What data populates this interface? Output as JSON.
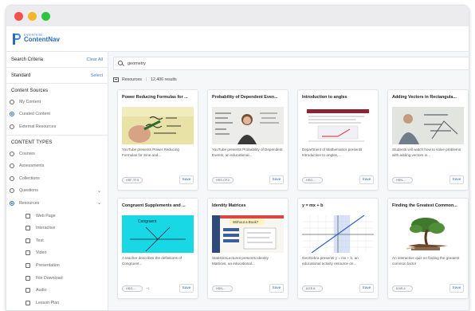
{
  "app": {
    "logo_small": "ENTERPRISE",
    "logo_big": "ContentNav"
  },
  "sidebar": {
    "search_criteria": "Search Criteria",
    "clear_all": "Clear All",
    "standard": "Standard",
    "select": "Select",
    "content_sources_heading": "Content Sources",
    "content_sources": [
      {
        "label": "My Content",
        "selected": false
      },
      {
        "label": "Curated Content",
        "selected": true
      },
      {
        "label": "External Resources",
        "selected": false
      }
    ],
    "content_types_heading": "CONTENT TYPES",
    "content_types": [
      {
        "label": "Courses",
        "selected": false,
        "expandable": false
      },
      {
        "label": "Assessments",
        "selected": false,
        "expandable": false
      },
      {
        "label": "Collections",
        "selected": false,
        "expandable": false
      },
      {
        "label": "Questions",
        "selected": false,
        "expandable": true
      },
      {
        "label": "Resources",
        "selected": true,
        "expandable": true
      }
    ],
    "resource_types": [
      "Web Page",
      "Interactive",
      "Text",
      "Video",
      "Presentation",
      "File Download",
      "Audio",
      "Lesson Plan"
    ]
  },
  "main": {
    "search_value": "geometry",
    "resources_label": "Resources",
    "results_count": "12,406 results",
    "save_label": "Save",
    "cards": [
      {
        "title": "Power Reducing Formulas for ...",
        "desc": "YouTube presents Power Reducing Formulas for Sine and...",
        "pill": "HSF-TF.5",
        "extra": ""
      },
      {
        "title": "Probability of Dependent Even...",
        "desc": "YouTube presents Probability of Dependent Events, an educational...",
        "pill": "HSS-CP.2",
        "extra": ""
      },
      {
        "title": "Introduction to angles",
        "desc": "Department of Mathematics presents Introduction to angles,...",
        "pill": "HSG-...",
        "extra": ""
      },
      {
        "title": "Adding Vectors in Rectangula...",
        "desc": "Students will watch how to solve problems with adding vectors in...",
        "pill": "HSN-...",
        "extra": ""
      },
      {
        "title": "Congruent Supplements and ...",
        "desc": "A teacher describes the definitions of Congruent...",
        "pill": "HSG-...",
        "extra": "+1"
      },
      {
        "title": "Identity Matrices",
        "desc": "StatisticsLectures presents Identity Matrices, an educational...",
        "pill": "HSN-...",
        "extra": ""
      },
      {
        "title": "y = mx + b",
        "desc": "GeoGebra presents y = mx + b, an educational activity resource on...",
        "pill": "8.EE.6",
        "extra": ""
      },
      {
        "title": "Finding the Greatest Common...",
        "desc": "An interactive quiz on finding the greatest common factor",
        "pill": "6.NS.4",
        "extra": ""
      }
    ],
    "thumb6_label": "Without a Book?"
  },
  "colors": {
    "brand_blue": "#2b6cb6",
    "cyan_thumb": "#19d8e6"
  }
}
